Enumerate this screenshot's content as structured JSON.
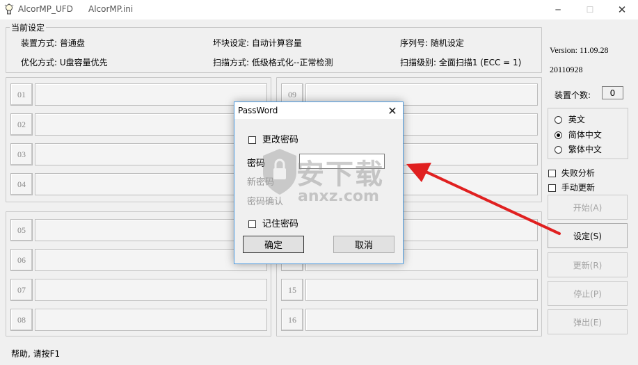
{
  "window": {
    "app_title": "AlcorMP_UFD",
    "ini_title": "AlcorMP.ini",
    "minimize_symbol": "─",
    "maximize_symbol": "☐",
    "close_symbol": "✕"
  },
  "settings": {
    "legend": "当前设定",
    "device_mode": "装置方式: 普通盘",
    "bad_block": "坏块设定: 自动计算容量",
    "serial": "序列号: 随机设定",
    "optimize": "优化方式: U盘容量优先",
    "scan_mode": "扫描方式: 低级格式化--正常检测",
    "scan_level": "扫描级别: 全面扫描1 (ECC = 1)"
  },
  "ports": {
    "left_top": [
      "01",
      "02",
      "03",
      "04"
    ],
    "left_bottom": [
      "05",
      "06",
      "07",
      "08"
    ],
    "right_top": [
      "09"
    ],
    "right_bottom": [
      "15",
      "16"
    ]
  },
  "right_panel": {
    "version": "Version: 11.09.28",
    "date": "20110928",
    "device_count_label": "装置个数:",
    "device_count_value": "0",
    "lang_english": "英文",
    "lang_simplified": "简体中文",
    "lang_traditional": "繁体中文",
    "selected_language": "简体中文",
    "fail_analysis": "失败分析",
    "manual_update": "手动更新",
    "btn_start": "开始(A)",
    "btn_settings": "设定(S)",
    "btn_refresh": "更新(R)",
    "btn_stop": "停止(P)",
    "btn_eject": "弹出(E)"
  },
  "dialog": {
    "title": "PassWord",
    "close_symbol": "✕",
    "change_password": "更改密码",
    "password_label": "密码",
    "new_password_label": "新密码",
    "confirm_password_label": "密码确认",
    "remember_password": "记住密码",
    "ok_button": "确定",
    "cancel_button": "取消"
  },
  "watermark": {
    "text_cn": "安下载",
    "text_en": "anxz.com"
  },
  "status_bar": {
    "help_text": "帮助, 请按F1"
  },
  "colors": {
    "arrow": "#e02020",
    "dialog_border": "#4a9ae0"
  }
}
